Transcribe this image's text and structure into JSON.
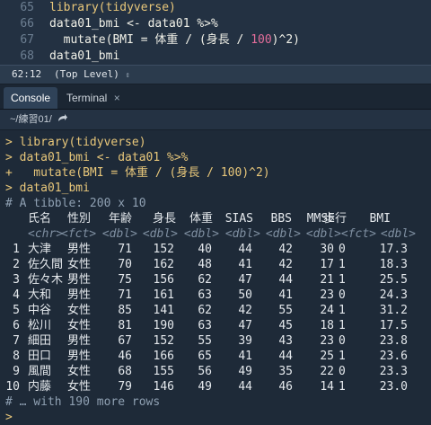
{
  "editor": {
    "lines": [
      {
        "num": "65",
        "parts": [
          {
            "t": "library(tidyverse)",
            "c": "kw"
          }
        ]
      },
      {
        "num": "66",
        "parts": [
          {
            "t": "data01_bmi <- data01 %>%",
            "c": ""
          }
        ]
      },
      {
        "num": "67",
        "parts": [
          {
            "t": "  mutate(BMI = 体重 / (身長 / ",
            "c": ""
          },
          {
            "t": "100",
            "c": "pink"
          },
          {
            "t": ")^2)",
            "c": ""
          }
        ]
      },
      {
        "num": "68",
        "parts": [
          {
            "t": "data01_bmi",
            "c": ""
          }
        ]
      }
    ]
  },
  "status": {
    "position": "62:12",
    "scope": "(Top Level)",
    "scope_icon": "chevron-updown-icon"
  },
  "tabs": [
    {
      "label": "Console",
      "active": true
    },
    {
      "label": "Terminal",
      "active": false,
      "close_icon": "close-icon"
    }
  ],
  "path": {
    "text": "~/練習01/",
    "icon": "go-to-directory-icon"
  },
  "console": {
    "commands": [
      "> library(tidyverse)",
      "> data01_bmi <- data01 %>%",
      "+   mutate(BMI = 体重 / (身長 / 100)^2)",
      "> data01_bmi"
    ],
    "tibble_comment": "# A tibble: 200 x 10",
    "columns": [
      "氏名",
      "性別",
      "年齢",
      "身長",
      "体重",
      "SIAS",
      "BBS",
      "MMSE",
      "歩行",
      "BMI"
    ],
    "types": [
      "<chr>",
      "<fct>",
      "<dbl>",
      "<dbl>",
      "<dbl>",
      "<dbl>",
      "<dbl>",
      "<dbl>",
      "<fct>",
      "<dbl>"
    ],
    "rows": [
      [
        "1",
        "大津",
        "男性",
        "71",
        "152",
        "40",
        "44",
        "42",
        "30",
        "0",
        "17.3"
      ],
      [
        "2",
        "佐久間",
        "女性",
        "70",
        "162",
        "48",
        "41",
        "42",
        "17",
        "1",
        "18.3"
      ],
      [
        "3",
        "佐々木",
        "男性",
        "75",
        "156",
        "62",
        "47",
        "44",
        "21",
        "1",
        "25.5"
      ],
      [
        "4",
        "大和",
        "男性",
        "71",
        "161",
        "63",
        "50",
        "41",
        "23",
        "0",
        "24.3"
      ],
      [
        "5",
        "中谷",
        "女性",
        "85",
        "141",
        "62",
        "42",
        "55",
        "24",
        "1",
        "31.2"
      ],
      [
        "6",
        "松川",
        "女性",
        "81",
        "190",
        "63",
        "47",
        "45",
        "18",
        "1",
        "17.5"
      ],
      [
        "7",
        "細田",
        "男性",
        "67",
        "152",
        "55",
        "39",
        "43",
        "23",
        "0",
        "23.8"
      ],
      [
        "8",
        "田口",
        "男性",
        "46",
        "166",
        "65",
        "41",
        "44",
        "25",
        "1",
        "23.6"
      ],
      [
        "9",
        "風間",
        "女性",
        "68",
        "155",
        "56",
        "49",
        "35",
        "22",
        "0",
        "23.3"
      ],
      [
        "10",
        "内藤",
        "女性",
        "79",
        "146",
        "49",
        "44",
        "46",
        "14",
        "1",
        "23.0"
      ]
    ],
    "more": "# … with 190 more rows",
    "prompt": ">"
  }
}
